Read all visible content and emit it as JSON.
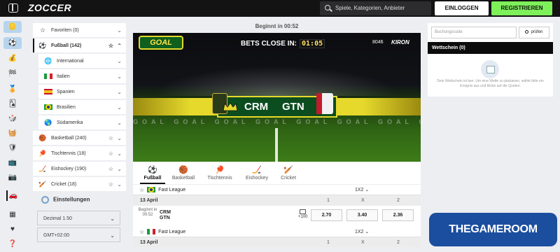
{
  "header": {
    "logo": "ZOCCER",
    "search_placeholder": "Spiele, Kategorien, Anbieter",
    "login_label": "EINLOGGEN",
    "register_label": "REGISTRIEREN"
  },
  "rail": {
    "icons": [
      "coin-icon",
      "sport-icon",
      "moneybag-icon",
      "racing-flag-icon",
      "medal-icon",
      "cards-icon",
      "dice-icon",
      "basket-icon",
      "shield-icon",
      "tv-icon",
      "camera-icon",
      "car-icon",
      "table-icon",
      "hearts-icon",
      "gift-icon",
      "help-icon"
    ]
  },
  "sidebar": {
    "items": [
      {
        "label": "Favoriten (0)",
        "icon": "star"
      },
      {
        "label": "Fußball (142)",
        "icon": "football"
      },
      {
        "label": "International",
        "icon": "globe"
      },
      {
        "label": "Italien",
        "icon": "flag-it"
      },
      {
        "label": "Spanien",
        "icon": "flag-es"
      },
      {
        "label": "Brasilien",
        "icon": "flag-br"
      },
      {
        "label": "Südamerika",
        "icon": "globe"
      },
      {
        "label": "Basketball (240)",
        "icon": "basketball"
      },
      {
        "label": "Tischtennis (18)",
        "icon": "table-tennis"
      },
      {
        "label": "Eishockey (190)",
        "icon": "ice-hockey"
      },
      {
        "label": "Cricket (18)",
        "icon": "cricket"
      }
    ],
    "settings_title": "Einstellungen",
    "odds_format": "Dezimal 1.50",
    "timezone": "GMT+02:00"
  },
  "stream": {
    "countdown": "Beginnt in 00:52",
    "bets_close_label": "BETS CLOSE IN:",
    "bets_close_timer": "01:05",
    "goal_logo": "GOAL",
    "video_id": "8046",
    "provider": "KIRON",
    "home_team": "CRM",
    "away_team": "GTN",
    "pitch_ads": "GOAL GOAL GOAL GOAL GOAL GOAL GOAL GOAL GOAL GOAL"
  },
  "sport_tabs": [
    {
      "label": "Fußball",
      "icon": "football"
    },
    {
      "label": "Basketball",
      "icon": "basketball"
    },
    {
      "label": "Tischtennis",
      "icon": "table-tennis"
    },
    {
      "label": "Eishockey",
      "icon": "ice-hockey"
    },
    {
      "label": "Cricket",
      "icon": "cricket"
    }
  ],
  "events": {
    "league1": "Fast League",
    "league2": "Fast League",
    "market": "1X2",
    "date1": "13 April",
    "date2": "13 April",
    "col_1": "1",
    "col_x": "X",
    "col_2": "2",
    "match": {
      "time_label": "Beginnt in 00:52",
      "home": "CRM",
      "away": "GTN",
      "more_markets": "+100",
      "odds": [
        "2.70",
        "3.40",
        "2.36"
      ]
    }
  },
  "betslip": {
    "code_placeholder": "Buchungscode",
    "code_button": "prüfen",
    "title": "Wettschein (0)",
    "empty_text": "Dein Wettschein ist leer. Um eine Wette zu platzieren, wähle bitte ein Ereignis aus und klicke auf die Quoten."
  },
  "watermark": "THEGAMEROOM",
  "colors": {
    "header_bg": "#131313",
    "register_green": "#7df05a",
    "banner_yellow": "#e6d92c",
    "watermark_blue": "#1b4e9e"
  }
}
